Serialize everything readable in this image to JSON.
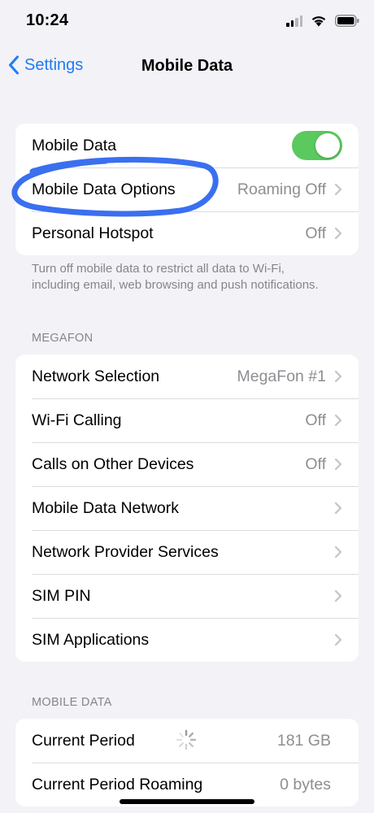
{
  "status_bar": {
    "time": "10:24"
  },
  "nav": {
    "back_label": "Settings",
    "title": "Mobile Data"
  },
  "group1": {
    "mobile_data": {
      "label": "Mobile Data",
      "toggle_on": true
    },
    "options": {
      "label": "Mobile Data Options",
      "value": "Roaming Off"
    },
    "hotspot": {
      "label": "Personal Hotspot",
      "value": "Off"
    }
  },
  "group1_footer": "Turn off mobile data to restrict all data to Wi-Fi, including email, web browsing and push notifications.",
  "carrier_section": {
    "header": "MEGAFON",
    "rows": [
      {
        "label": "Network Selection",
        "value": "MegaFon #1"
      },
      {
        "label": "Wi-Fi Calling",
        "value": "Off"
      },
      {
        "label": "Calls on Other Devices",
        "value": "Off"
      },
      {
        "label": "Mobile Data Network",
        "value": ""
      },
      {
        "label": "Network Provider Services",
        "value": ""
      },
      {
        "label": "SIM PIN",
        "value": ""
      },
      {
        "label": "SIM Applications",
        "value": ""
      }
    ]
  },
  "usage_section": {
    "header": "MOBILE DATA",
    "rows": [
      {
        "label": "Current Period",
        "value": "181 GB"
      },
      {
        "label": "Current Period Roaming",
        "value": "0 bytes"
      }
    ]
  },
  "colors": {
    "accent": "#1e7cf2",
    "toggle_on": "#5ac95e",
    "annotation": "#3a6ff0",
    "background": "#f2f2f7"
  }
}
